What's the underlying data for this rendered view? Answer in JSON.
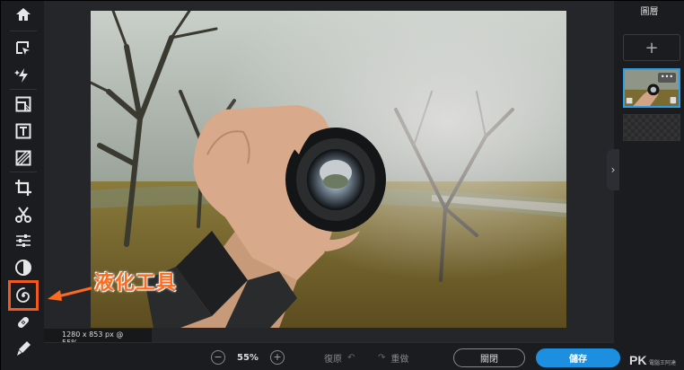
{
  "toolbar": {
    "tools": [
      {
        "name": "home-icon"
      },
      {
        "name": "arrange-icon"
      },
      {
        "name": "quick-fix-icon"
      },
      {
        "name": "layout-icon"
      },
      {
        "name": "text-icon"
      },
      {
        "name": "texture-icon"
      },
      {
        "name": "crop-icon"
      },
      {
        "name": "cutout-icon"
      },
      {
        "name": "adjust-icon"
      },
      {
        "name": "filter-icon"
      },
      {
        "name": "liquify-icon",
        "active": true
      },
      {
        "name": "healing-icon"
      },
      {
        "name": "draw-icon"
      }
    ]
  },
  "annotation": {
    "label": "液化工具",
    "color": "#ff6a1e"
  },
  "canvas": {
    "size_readout": "1280 x 853 px @ 55%"
  },
  "layers": {
    "title": "圖層",
    "add_label": "+",
    "menu_label": "•••"
  },
  "bottom": {
    "zoom_out": "−",
    "zoom_level": "55%",
    "zoom_in": "+",
    "undo_label": "復原",
    "redo_label": "重做",
    "close_label": "關閉",
    "save_label": "儲存"
  },
  "watermark": {
    "logo": "PK",
    "sub": "電腦王阿達"
  },
  "colors": {
    "accent": "#1d8fe0",
    "highlight": "#f25a1d",
    "background": "#1f2023"
  }
}
